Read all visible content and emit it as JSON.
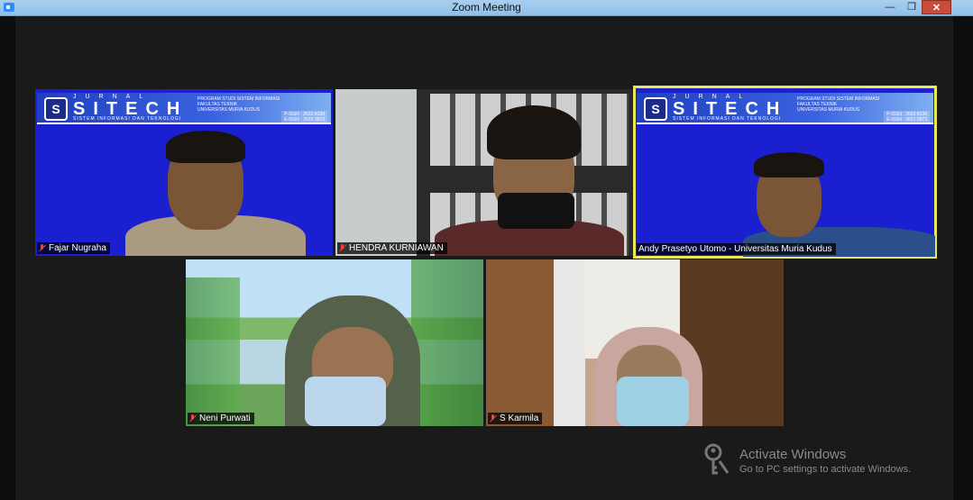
{
  "window": {
    "title": "Zoom Meeting",
    "minimize": "—",
    "maximize": "❐",
    "close": "✕"
  },
  "banner": {
    "jurnal": "JURNAL",
    "brand": "SITECH",
    "subtitle": "SISTEM INFORMASI DAN TEKNOLOGI",
    "info": [
      "PROGRAM STUDI SISTEM INFORMASI",
      "FAKULTAS TEKNIK",
      "UNIVERSITAS MURIA KUDUS"
    ],
    "issn": [
      "P-ISSN : 2622-8130",
      "E-ISSN : 2622-3973"
    ]
  },
  "participants": [
    {
      "name": "Fajar Nugraha",
      "muted": true,
      "active": false,
      "background": "sitech-banner"
    },
    {
      "name": "HENDRA KURNIAWAN",
      "muted": true,
      "active": false,
      "background": "office-shelves"
    },
    {
      "name": "Andy Prasetyo Utomo - Universitas Muria Kudus",
      "muted": false,
      "active": true,
      "background": "sitech-banner"
    },
    {
      "name": "Neni Purwati",
      "muted": true,
      "active": false,
      "background": "lake-flowers"
    },
    {
      "name": "S Karmila",
      "muted": true,
      "active": false,
      "background": "home-shelves"
    }
  ],
  "watermark": {
    "title": "Activate Windows",
    "subtitle": "Go to PC settings to activate Windows."
  },
  "colors": {
    "active_border": "#e8e85a",
    "muted_icon": "#e44444",
    "banner_blue": "#1a1fcf"
  }
}
